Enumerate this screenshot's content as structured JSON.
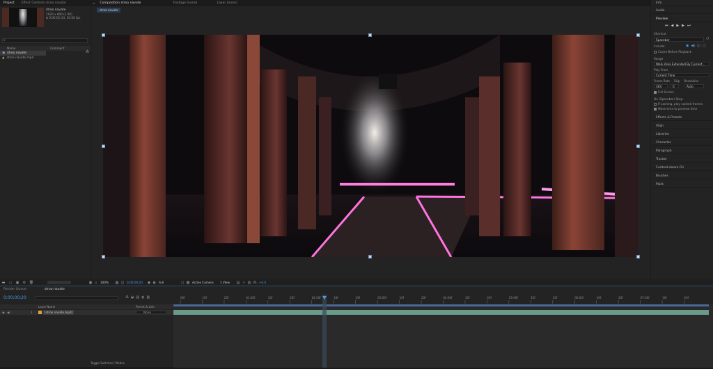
{
  "project": {
    "tabs": [
      "Project",
      "Effect Controls  stroo navate"
    ],
    "item_name": "stroo navate",
    "item_info_1": "1920 x 800 (1.00)",
    "item_info_2": "Δ 0;00;01;14, 30.00 fps",
    "search_placeholder": "",
    "col_name": "Name",
    "col_type": "Comment",
    "items": [
      {
        "name": "stroo navate",
        "icon": "composition-icon"
      },
      {
        "name": "stroo navate.mp4",
        "icon": "footage-icon"
      }
    ]
  },
  "comp": {
    "tabs": [
      "Composition  stroo navate",
      "Footage  (none)",
      "Layer  (none)"
    ],
    "breadcrumb": "stroo navate",
    "zoom": "100%",
    "timecode": "0;00;00;20",
    "resolution": "Full",
    "camera": "Active Camera",
    "views": "1 View",
    "exposure": "+0.0"
  },
  "right": {
    "panels_top": [
      "Info",
      "Audio",
      "Preview"
    ],
    "shortcut_label": "Shortcut",
    "shortcut_value": "Spacebar",
    "include_label": "Include:",
    "cache_label": "Cache Before Playback",
    "range_label": "Range",
    "range_value": "Work Area Extended By Current...",
    "play_from_label": "Play From",
    "play_from_value": "Current Time",
    "frame_rate_label": "Frame Rate",
    "skip_label": "Skip",
    "resolution_label": "Resolution",
    "frame_rate_value": "(30)",
    "skip_value": "0",
    "resolution_value": "Auto",
    "full_screen_label": "Full Screen",
    "on_stop_label": "On (Spacebar) Stop:",
    "if_caching_label": "If caching, play cached frames",
    "move_time_label": "Move time to preview time",
    "panels_bottom": [
      "Effects & Presets",
      "Align",
      "Libraries",
      "Character",
      "Paragraph",
      "Tracker",
      "Content-Aware Fill",
      "Brushes",
      "Paint"
    ]
  },
  "timeline": {
    "tabs": [
      "Render Queue",
      "stroo navate"
    ],
    "timecode": "0;00;00;20",
    "col_layer": "Layer Name",
    "col_parent": "Parent & Link",
    "layer_num": "1",
    "layer_name": "[stroo navate.mp4]",
    "parent_value": "None",
    "ruler_labels": [
      "00f",
      "10f",
      "20f",
      "01:00f",
      "10f",
      "20f",
      "02:00f",
      "10f",
      "20f",
      "03:00f",
      "10f",
      "20f",
      "04:00f",
      "10f",
      "20f",
      "05:00f",
      "10f",
      "20f",
      "06:00f",
      "10f",
      "20f",
      "07:00f",
      "10f",
      "20f"
    ],
    "playhead_fraction": 0.28,
    "toggle_label": "Toggle Switches / Modes"
  },
  "colors": {
    "accent": "#4b9be8",
    "track": "#6a9a8a",
    "neon": "#ff5fd8"
  }
}
